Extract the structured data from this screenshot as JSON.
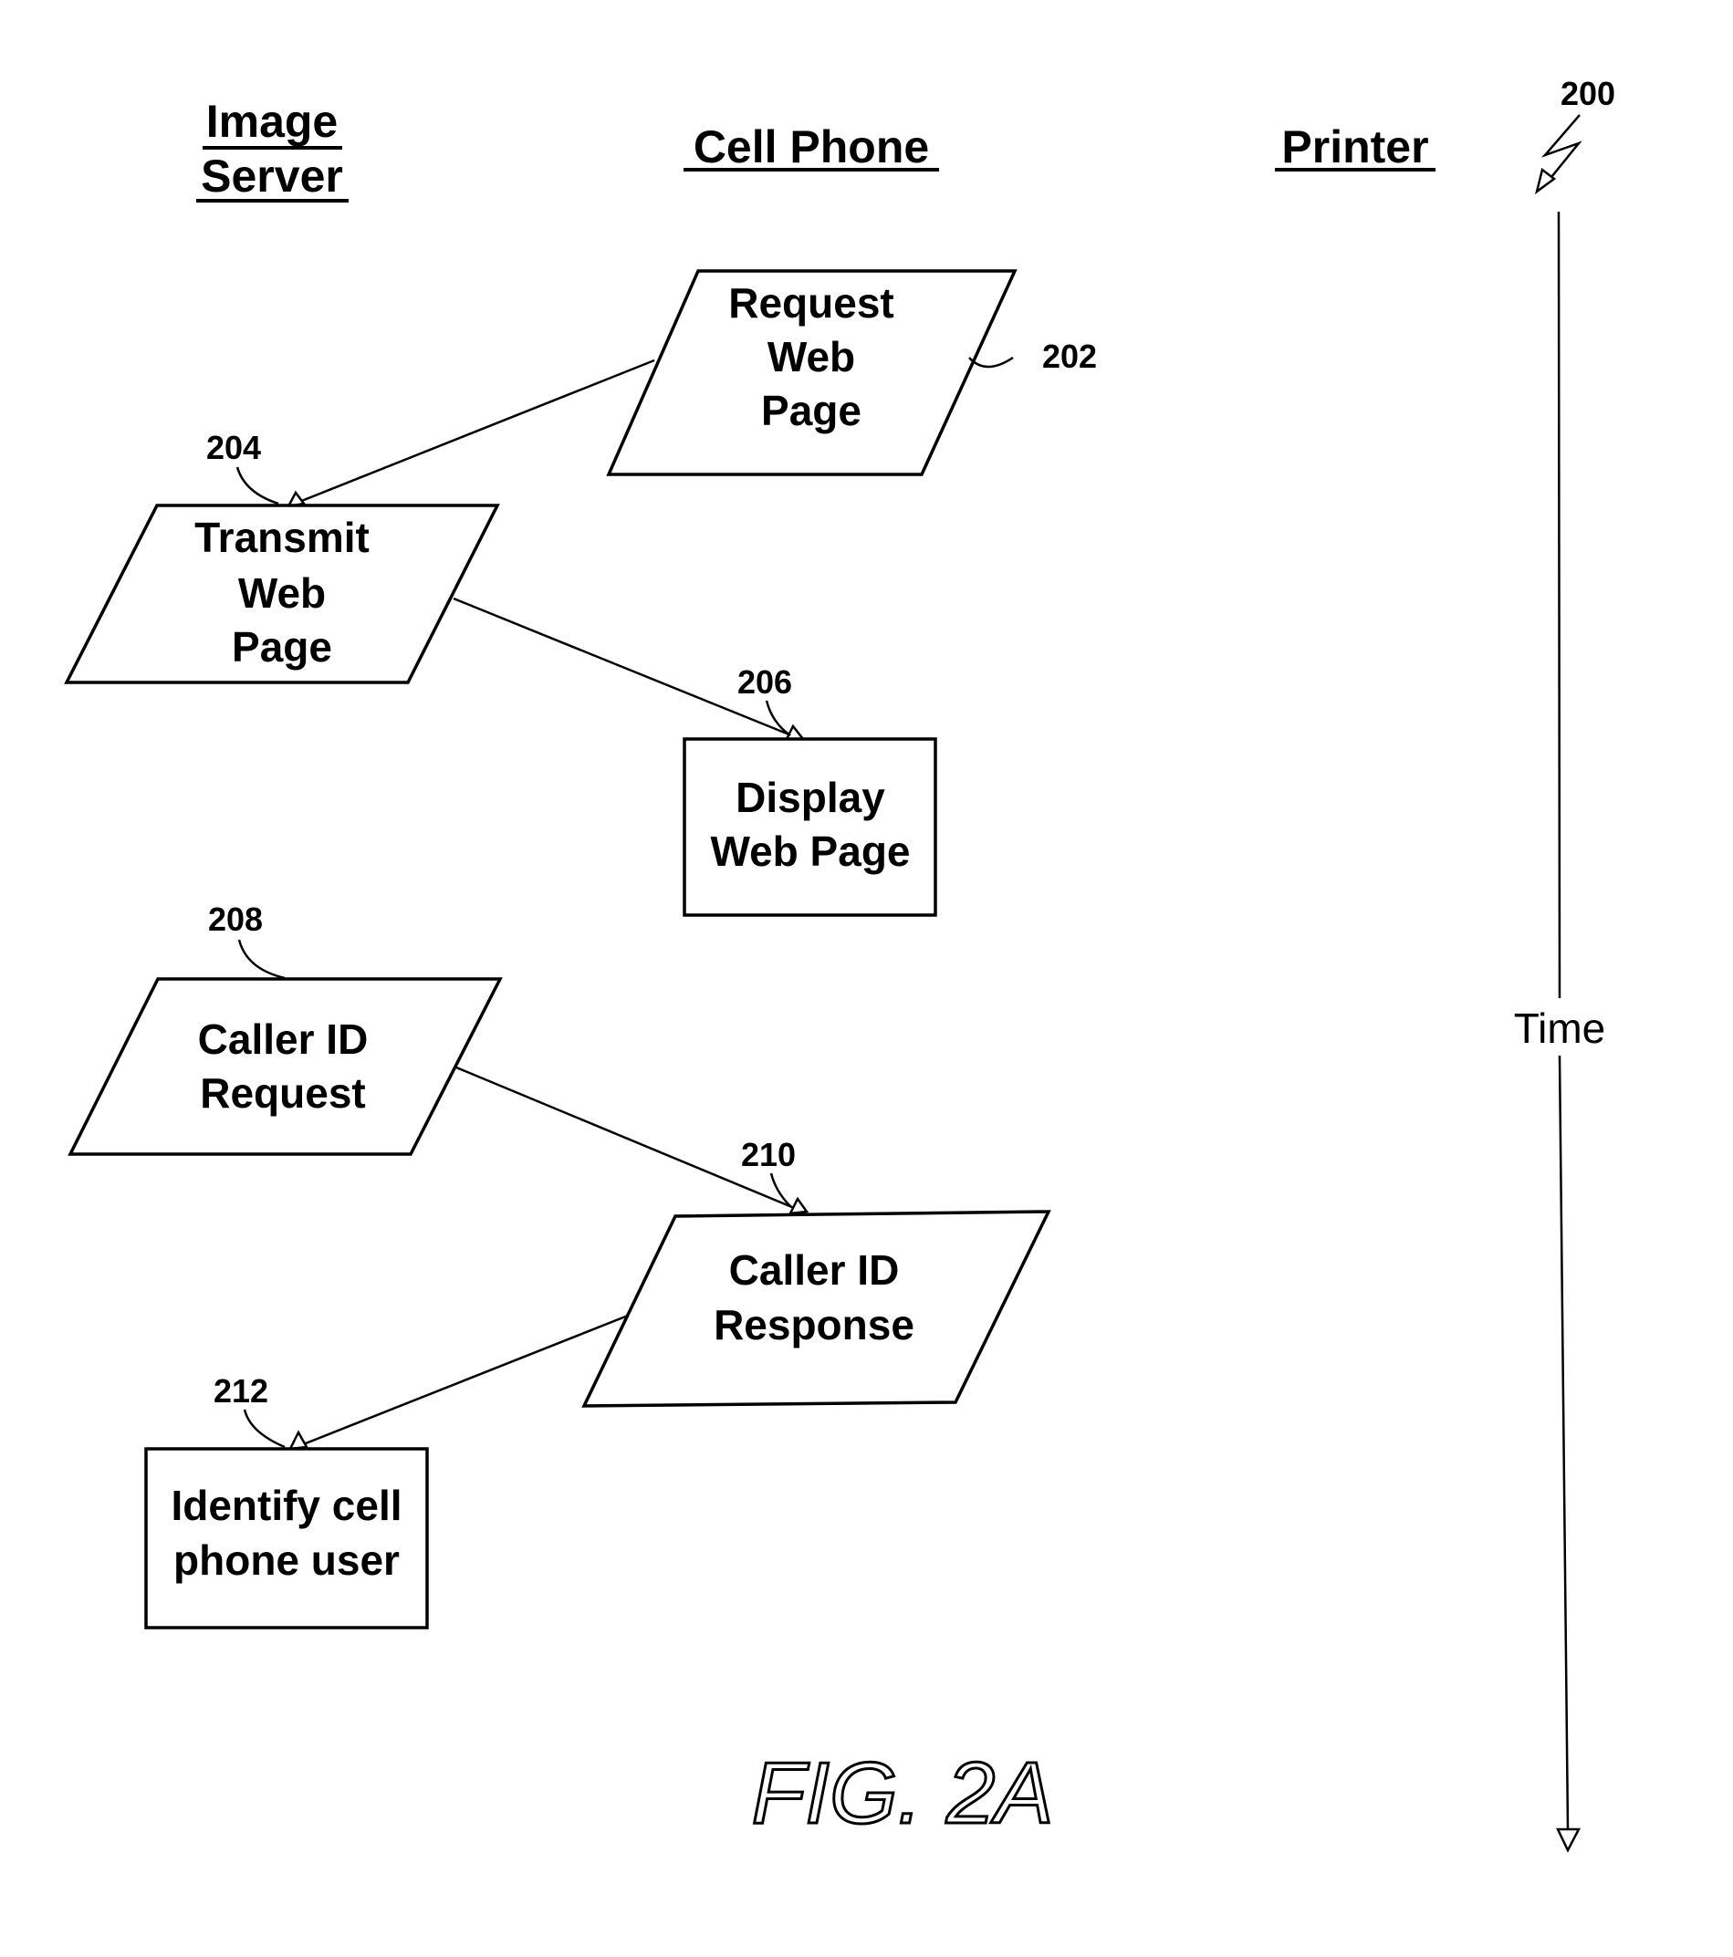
{
  "figure": {
    "reference_number": "200",
    "caption": "FIG. 2A",
    "time_axis_label": "Time"
  },
  "lanes": [
    {
      "id": "image-server",
      "label_lines": [
        "Image",
        "Server"
      ]
    },
    {
      "id": "cell-phone",
      "label_lines": [
        "Cell Phone"
      ]
    },
    {
      "id": "printer",
      "label_lines": [
        "Printer"
      ]
    }
  ],
  "steps": [
    {
      "ref": "202",
      "lane": "cell-phone",
      "shape": "parallelogram",
      "lines": [
        "Request",
        "Web",
        "Page"
      ]
    },
    {
      "ref": "204",
      "lane": "image-server",
      "shape": "parallelogram",
      "lines": [
        "Transmit",
        "Web",
        "Page"
      ]
    },
    {
      "ref": "206",
      "lane": "cell-phone",
      "shape": "rectangle",
      "lines": [
        "Display",
        "Web Page"
      ]
    },
    {
      "ref": "208",
      "lane": "image-server",
      "shape": "parallelogram",
      "lines": [
        "Caller ID",
        "Request"
      ]
    },
    {
      "ref": "210",
      "lane": "cell-phone",
      "shape": "parallelogram",
      "lines": [
        "Caller ID",
        "Response"
      ]
    },
    {
      "ref": "212",
      "lane": "image-server",
      "shape": "rectangle",
      "lines": [
        "Identify cell",
        "phone user"
      ]
    }
  ],
  "connections": [
    {
      "from": "202",
      "to": "204"
    },
    {
      "from": "204",
      "to": "206"
    },
    {
      "from": "208",
      "to": "210"
    },
    {
      "from": "210",
      "to": "212"
    }
  ]
}
